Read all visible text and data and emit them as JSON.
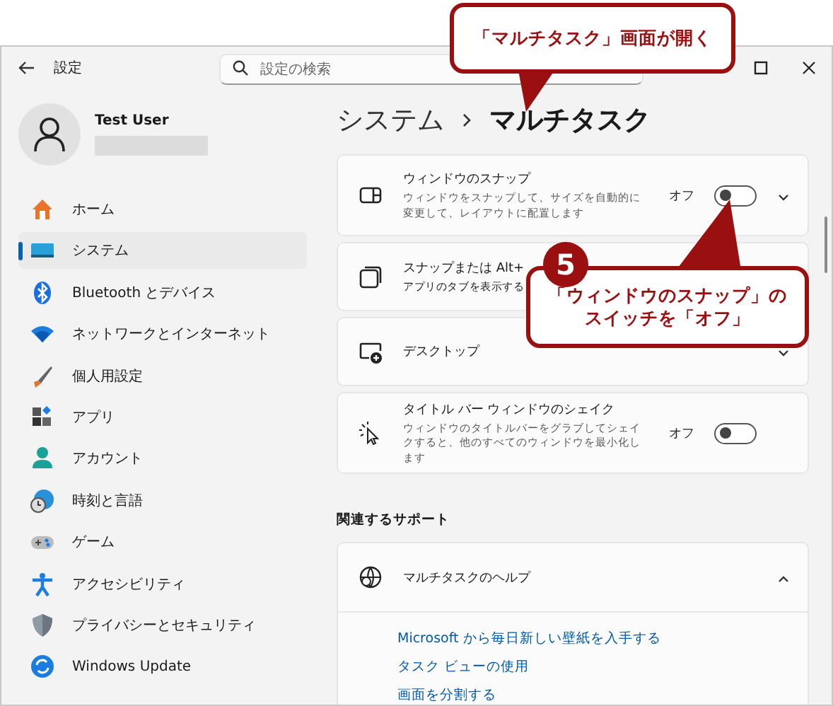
{
  "window": {
    "title": "設定",
    "search": {
      "placeholder": "設定の検索"
    }
  },
  "user": {
    "name": "Test User"
  },
  "nav": [
    {
      "label": "ホーム",
      "selected": false
    },
    {
      "label": "システム",
      "selected": true
    },
    {
      "label": "Bluetooth とデバイス",
      "selected": false
    },
    {
      "label": "ネットワークとインターネット",
      "selected": false
    },
    {
      "label": "個人用設定",
      "selected": false
    },
    {
      "label": "アプリ",
      "selected": false
    },
    {
      "label": "アカウント",
      "selected": false
    },
    {
      "label": "時刻と言語",
      "selected": false
    },
    {
      "label": "ゲーム",
      "selected": false
    },
    {
      "label": "アクセシビリティ",
      "selected": false
    },
    {
      "label": "プライバシーとセキュリティ",
      "selected": false
    },
    {
      "label": "Windows Update",
      "selected": false
    }
  ],
  "breadcrumb": [
    "システム",
    "マルチタスク"
  ],
  "settings": [
    {
      "kind": "toggle",
      "title": "ウィンドウのスナップ",
      "description": "ウィンドウをスナップして、サイズを自動的に変更して、レイアウトに配置します",
      "state_label": "オフ",
      "on": false,
      "expandable": true
    },
    {
      "kind": "plain",
      "title": "スナップまたは Alt+",
      "description": "アプリのタブを表示する"
    },
    {
      "kind": "expand",
      "title": "デスクトップ"
    },
    {
      "kind": "toggle",
      "title": "タイトル バー ウィンドウのシェイク",
      "description": "ウィンドウのタイトルバーをグラブしてシェイクすると、他のすべてのウィンドウを最小化します",
      "state_label": "オフ",
      "on": false,
      "expandable": false
    }
  ],
  "support": {
    "heading": "関連するサポート",
    "title": "マルチタスクのヘルプ",
    "expanded": true,
    "links": [
      "Microsoft から毎日新しい壁紙を入手する",
      "タスク ビューの使用",
      "画面を分割する"
    ]
  },
  "callouts": [
    {
      "text": "「マルチタスク」画面が開く"
    },
    {
      "badge": "5",
      "lines": [
        "「ウィンドウのスナップ」の",
        "スイッチを「オフ」"
      ]
    }
  ]
}
